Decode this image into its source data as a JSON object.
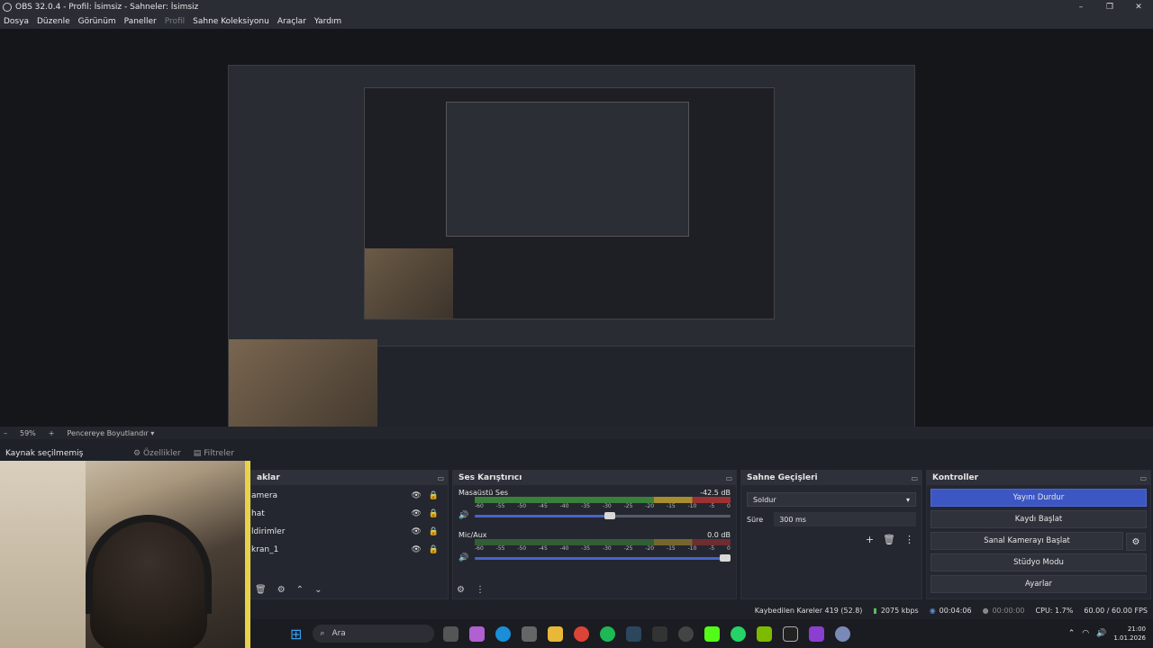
{
  "window": {
    "title": "OBS 32.0.4 - Profil: İsimsiz - Sahneler: İsimsiz",
    "controls": [
      "–",
      "❐",
      "✕"
    ]
  },
  "menu": {
    "items": [
      "Dosya",
      "Düzenle",
      "Görünüm",
      "Paneller"
    ],
    "disabled": "Profil",
    "items2": [
      "Sahne Koleksiyonu",
      "Araçlar",
      "Yardım"
    ]
  },
  "zoombar": {
    "minus": "–",
    "zoom": "59%",
    "plus": "+",
    "mode": "Pencereye Boyutlandır"
  },
  "source_info": {
    "label": "Kaynak seçilmemiş",
    "properties": "Özellikler",
    "filters": "Filtreler"
  },
  "sources": {
    "title": "aklar",
    "items": [
      "amera",
      "hat",
      "ldirimler",
      "kran_1"
    ]
  },
  "mixer": {
    "title": "Ses Karıştırıcı",
    "ticks": [
      "-60",
      "-55",
      "-50",
      "-45",
      "-40",
      "-35",
      "-30",
      "-25",
      "-20",
      "-15",
      "-10",
      "-5",
      "0"
    ],
    "channels": [
      {
        "name": "Masaüstü Ses",
        "db": "-42.5 dB",
        "volume_percent": 55
      },
      {
        "name": "Mic/Aux",
        "db": "0.0 dB",
        "volume_percent": 100
      }
    ]
  },
  "transitions": {
    "title": "Sahne Geçişleri",
    "selected": "Soldur",
    "duration_label": "Süre",
    "duration_value": "300 ms"
  },
  "controls": {
    "title": "Kontroller",
    "stop_stream": "Yayını Durdur",
    "start_record": "Kaydı Başlat",
    "virtual_cam": "Sanal Kamerayı Başlat",
    "studio_mode": "Stüdyo Modu",
    "settings": "Ayarlar"
  },
  "status": {
    "dropped": "Kaybedilen Kareler 419 (52.8)",
    "bitrate": "2075 kbps",
    "stream_time": "00:04:06",
    "rec_time": "00:00:00",
    "cpu": "CPU: 1.7%",
    "fps": "60.00 / 60.00 FPS"
  },
  "taskbar": {
    "search": "Ara",
    "time": "21:00",
    "date": "1.01.2026"
  },
  "colors": {
    "accent": "#3c57c4",
    "bg": "#1f2128"
  }
}
